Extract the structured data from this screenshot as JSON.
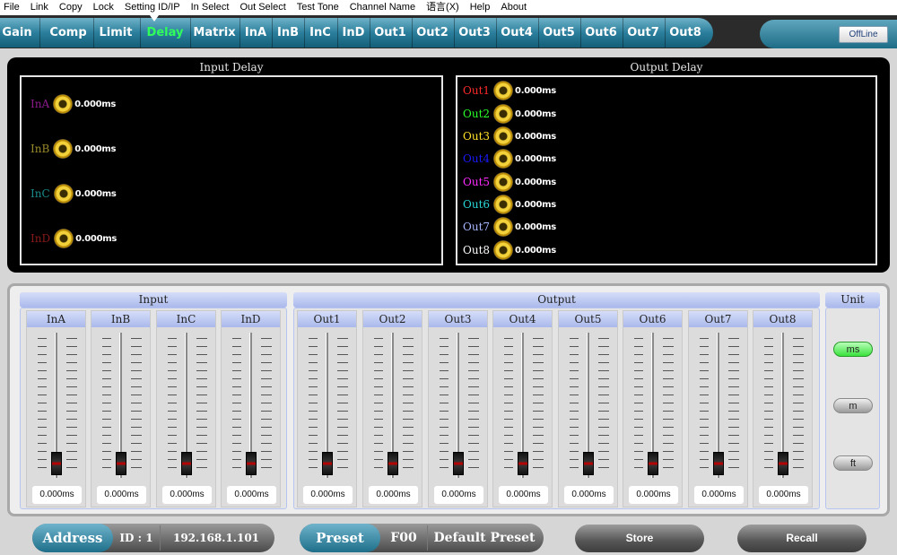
{
  "menu": [
    "File",
    "Link",
    "Copy",
    "Lock",
    "Setting ID/IP",
    "In Select",
    "Out Select",
    "Test Tone",
    "Channel Name",
    "语言(X)",
    "Help",
    "About"
  ],
  "tabs": [
    "Gain",
    "Comp",
    "Limit",
    "Delay",
    "Matrix",
    "InA",
    "InB",
    "InC",
    "InD",
    "Out1",
    "Out2",
    "Out3",
    "Out4",
    "Out5",
    "Out6",
    "Out7",
    "Out8"
  ],
  "active_tab": "Delay",
  "status": {
    "offline_label": "OffLine"
  },
  "input_delay": {
    "title": "Input Delay",
    "channels": [
      {
        "name": "InA",
        "value": "0.000ms",
        "color": "#8b1a8b"
      },
      {
        "name": "InB",
        "value": "0.000ms",
        "color": "#9a8a2a"
      },
      {
        "name": "InC",
        "value": "0.000ms",
        "color": "#1a8a8a"
      },
      {
        "name": "InD",
        "value": "0.000ms",
        "color": "#8b1a1a"
      }
    ]
  },
  "output_delay": {
    "title": "Output Delay",
    "channels": [
      {
        "name": "Out1",
        "value": "0.000ms",
        "color": "#ff2a2a"
      },
      {
        "name": "Out2",
        "value": "0.000ms",
        "color": "#2aff2a"
      },
      {
        "name": "Out3",
        "value": "0.000ms",
        "color": "#ffe02a"
      },
      {
        "name": "Out4",
        "value": "0.000ms",
        "color": "#1a1aff"
      },
      {
        "name": "Out5",
        "value": "0.000ms",
        "color": "#ff2aff"
      },
      {
        "name": "Out6",
        "value": "0.000ms",
        "color": "#2ad8d8"
      },
      {
        "name": "Out7",
        "value": "0.000ms",
        "color": "#a8b8ff"
      },
      {
        "name": "Out8",
        "value": "0.000ms",
        "color": "#ffffff"
      }
    ]
  },
  "faders": {
    "input_title": "Input",
    "output_title": "Output",
    "inputs": [
      {
        "name": "InA",
        "value": "0.000ms"
      },
      {
        "name": "InB",
        "value": "0.000ms"
      },
      {
        "name": "InC",
        "value": "0.000ms"
      },
      {
        "name": "InD",
        "value": "0.000ms"
      }
    ],
    "outputs": [
      {
        "name": "Out1",
        "value": "0.000ms"
      },
      {
        "name": "Out2",
        "value": "0.000ms"
      },
      {
        "name": "Out3",
        "value": "0.000ms"
      },
      {
        "name": "Out4",
        "value": "0.000ms"
      },
      {
        "name": "Out5",
        "value": "0.000ms"
      },
      {
        "name": "Out6",
        "value": "0.000ms"
      },
      {
        "name": "Out7",
        "value": "0.000ms"
      },
      {
        "name": "Out8",
        "value": "0.000ms"
      }
    ],
    "fader_level": 0
  },
  "unit": {
    "title": "Unit",
    "options": [
      "ms",
      "m",
      "ft"
    ],
    "selected": "ms"
  },
  "bottom": {
    "address_label": "Address",
    "id_label": "ID : 1",
    "ip": "192.168.1.101",
    "preset_label": "Preset",
    "preset_code": "F00",
    "preset_name": "Default Preset",
    "store_label": "Store",
    "recall_label": "Recall"
  }
}
